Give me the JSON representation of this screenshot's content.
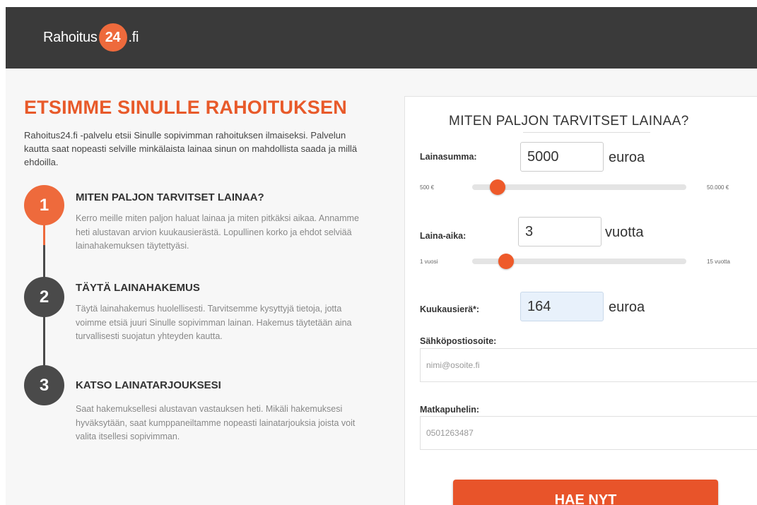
{
  "header": {
    "logo_left": "Rahoitus",
    "logo_badge": "24",
    "logo_right": ".fi"
  },
  "intro": {
    "title": "ETSIMME SINULLE RAHOITUKSEN",
    "text": "Rahoitus24.fi -palvelu etsii Sinulle sopivimman rahoituksen ilmaiseksi. Palvelun kautta saat nopeasti selville minkälaista lainaa sinun on mahdollista saada ja millä ehdoilla."
  },
  "steps": [
    {
      "number": "1",
      "title": "MITEN PALJON TARVITSET LAINAA?",
      "text": "Kerro meille miten paljon haluat lainaa ja miten pitkäksi aikaa. Annamme heti alustavan arvion kuukausierästä. Lopullinen korko ja ehdot selviää lainahakemuksen täytettyäsi."
    },
    {
      "number": "2",
      "title": "TÄYTÄ LAINAHAKEMUS",
      "text": "Täytä lainahakemus huolellisesti. Tarvitsemme kysyttyjä tietoja, jotta voimme etsiä juuri Sinulle sopivimman lainan. Hakemus täytetään aina turvallisesti suojatun yhteyden kautta."
    },
    {
      "number": "3",
      "title": "KATSO LAINATARJOUKSESI",
      "text": "Saat hakemuksellesi alustavan vastauksen heti. Mikäli hakemuksesi hyväksytään, saat kumppaneiltamme nopeasti lainatarjouksia joista voit valita itsellesi sopivimman."
    }
  ],
  "form": {
    "title": "MITEN PALJON TARVITSET LAINAA?",
    "amount": {
      "label": "Lainasumma:",
      "value": "5000",
      "unit": "euroa",
      "min_label": "500 €",
      "max_label": "50.000 €",
      "slider_fraction": 0.12
    },
    "term": {
      "label": "Laina-aika:",
      "value": "3",
      "unit": "vuotta",
      "min_label": "1 vuosi",
      "max_label": "15 vuotta",
      "slider_fraction": 0.16
    },
    "monthly": {
      "label": "Kuukausierä*:",
      "value": "164",
      "unit": "euroa"
    },
    "email": {
      "label": "Sähköpostiosoite:",
      "placeholder": "nimi@osoite.fi"
    },
    "phone": {
      "label": "Matkapuhelin:",
      "placeholder": "0501263487"
    },
    "submit_label": "HAE NYT"
  },
  "colors": {
    "accent": "#e8542a",
    "header_bg": "#3a3a3a",
    "step_dark": "#4a4a4a"
  }
}
